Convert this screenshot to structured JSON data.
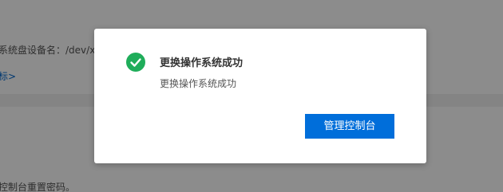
{
  "background": {
    "device_line": "系统盘设备名：/dev/xv",
    "link_text": "标>",
    "bottom_line": "控制台重置密码。"
  },
  "dialog": {
    "title": "更换操作系统成功",
    "message": "更换操作系统成功",
    "primary_button": "管理控制台",
    "status_icon": "check-circle-icon"
  },
  "colors": {
    "success": "#1fad5a",
    "primary": "#006eda"
  }
}
